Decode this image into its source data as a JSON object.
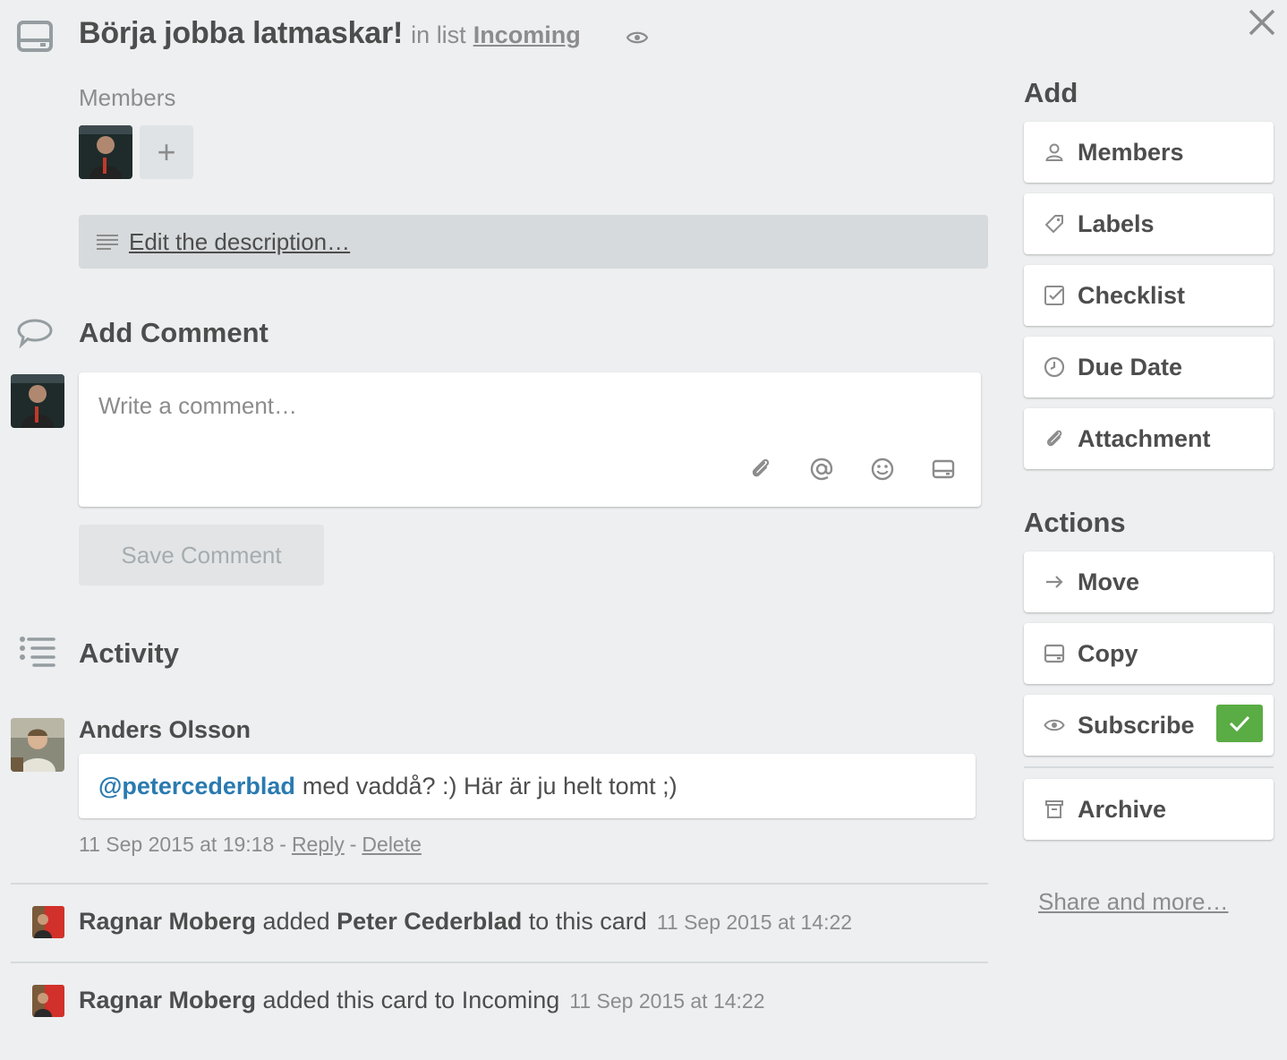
{
  "card": {
    "title": "Börja jobba latmaskar!",
    "in_list_prefix": "in list",
    "list_name": "Incoming"
  },
  "members": {
    "label": "Members",
    "add_symbol": "+"
  },
  "description": {
    "link_text": "Edit the description…"
  },
  "add_comment": {
    "heading": "Add Comment",
    "placeholder": "Write a comment…",
    "save_label": "Save Comment"
  },
  "activity": {
    "heading": "Activity",
    "comment": {
      "author": "Anders Olsson",
      "mention": "@petercederblad",
      "text": "med vaddå? :) Här är ju helt tomt ;)",
      "timestamp": "11 Sep 2015 at 19:18",
      "sep1": "-",
      "reply": "Reply",
      "sep2": "-",
      "delete": "Delete"
    },
    "items": [
      {
        "actor": "Ragnar Moberg",
        "verb": "added",
        "object": "Peter Cederblad",
        "suffix": "to this card",
        "date": "11 Sep 2015 at 14:22"
      },
      {
        "actor": "Ragnar Moberg",
        "verb": "added this card to Incoming",
        "date": "11 Sep 2015 at 14:22"
      }
    ]
  },
  "sidebar": {
    "add_heading": "Add",
    "add_buttons": [
      "Members",
      "Labels",
      "Checklist",
      "Due Date",
      "Attachment"
    ],
    "actions_heading": "Actions",
    "action_buttons": [
      "Move",
      "Copy",
      "Subscribe"
    ],
    "archive_label": "Archive",
    "share_link": "Share and more…",
    "subscribed": true
  },
  "colors": {
    "background": "#edeff0",
    "mention": "#2a7ab0",
    "subscribe_check": "#5aac44"
  }
}
